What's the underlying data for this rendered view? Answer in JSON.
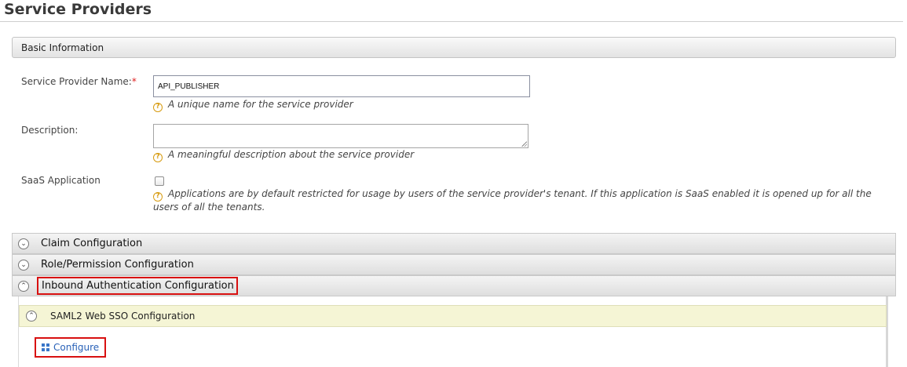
{
  "page": {
    "title": "Service Providers"
  },
  "basic_info": {
    "header": "Basic Information",
    "name_label": "Service Provider Name:",
    "required_mark": "*",
    "name_value": "API_PUBLISHER",
    "name_hint": "A unique name for the service provider",
    "description_label": "Description:",
    "description_value": "",
    "description_hint": "A meaningful description about the service provider",
    "saas_label": "SaaS Application",
    "saas_checked": false,
    "saas_hint": "Applications are by default restricted for usage by users of the service provider's tenant. If this application is SaaS enabled it is opened up for all the users of all the tenants."
  },
  "icons": {
    "help": "?",
    "expand": "⌄",
    "collapse": "⌃"
  },
  "accordions": [
    {
      "label": "Claim Configuration",
      "state": "collapsed"
    },
    {
      "label": "Role/Permission Configuration",
      "state": "collapsed"
    },
    {
      "label": "Inbound Authentication Configuration",
      "state": "expanded",
      "highlighted": true
    }
  ],
  "inbound": {
    "saml_label": "SAML2 Web SSO Configuration",
    "configure_link": "Configure"
  },
  "colors": {
    "highlight": "#d81010",
    "link": "#2a62b8",
    "help_icon": "#d79b10",
    "sub_header_bg": "#f5f5d5"
  }
}
